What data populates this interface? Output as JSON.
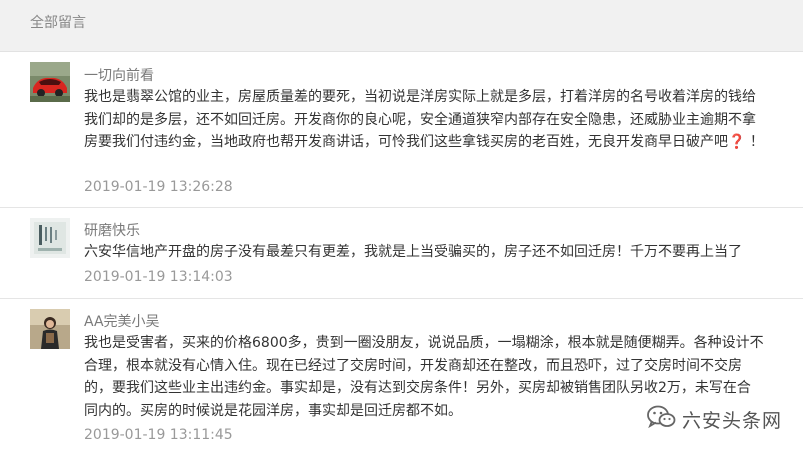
{
  "header": {
    "title": "全部留言"
  },
  "comments": [
    {
      "nickname": "一切向前看",
      "avatar": "red-car-avatar",
      "text": "我也是翡翠公馆的业主，房屋质量差的要死，当初说是洋房实际上就是多层，打着洋房的名号收着洋房的钱给我们却的是多层，还不如回迁房。开发商你的良心呢，安全通道狭窄内部存在安全隐患，还威胁业主逾期不拿房要我们付违约金，当地政府也帮开发商讲话，可怜我们这些拿钱买房的老百姓，无良开发商早日破产吧",
      "emoji": "❓",
      "suffix": "！",
      "time": "2019-01-19 13:26:28"
    },
    {
      "nickname": "研磨快乐",
      "avatar": "book-cover-avatar",
      "text": "六安华信地产开盘的房子没有最差只有更差，我就是上当受骗买的，房子还不如回迁房！千万不要再上当了",
      "time": "2019-01-19 13:14:03"
    },
    {
      "nickname": "AA完美小吴",
      "avatar": "person-avatar",
      "text": "我也是受害者，买来的价格6800多，贵到一圈没朋友，说说品质，一塌糊涂，根本就是随便糊弄。各种设计不合理，根本就没有心情入住。现在已经过了交房时间，开发商却还在整改，而且恐吓，过了交房时间不交房的，要我们这些业主出违约金。事实却是，没有达到交房条件！另外，买房却被销售团队另收2万，未写在合同内的。买房的时候说是花园洋房，事实却是回迁房都不如。",
      "time": "2019-01-19 13:11:45"
    }
  ],
  "watermark": {
    "text": "六安头条网",
    "icon": "wechat-icon"
  }
}
